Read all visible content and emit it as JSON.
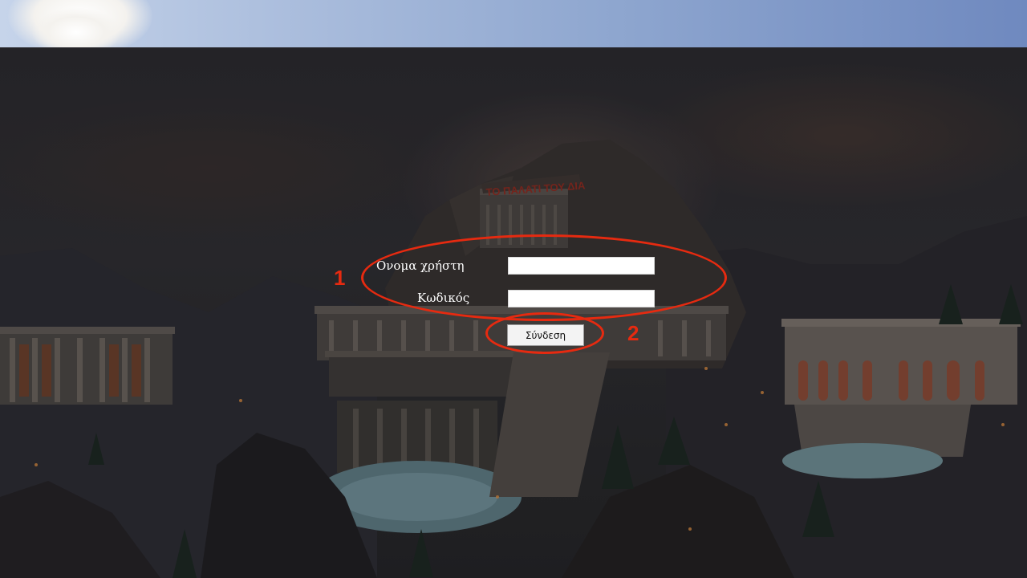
{
  "login": {
    "username_label": "Ονομα χρήστη",
    "username_value": "",
    "password_label": "Κωδικός",
    "password_value": "",
    "submit_label": "Σύνδεση"
  },
  "scene": {
    "sign_text": "ΤΟ ΠΑΛΑΤΙ ΤΟΥ ΔΙΑ"
  },
  "annotations": [
    {
      "number": "1"
    },
    {
      "number": "2"
    }
  ],
  "colors": {
    "annotation": "#e62a10",
    "label_text": "#ffffff"
  }
}
